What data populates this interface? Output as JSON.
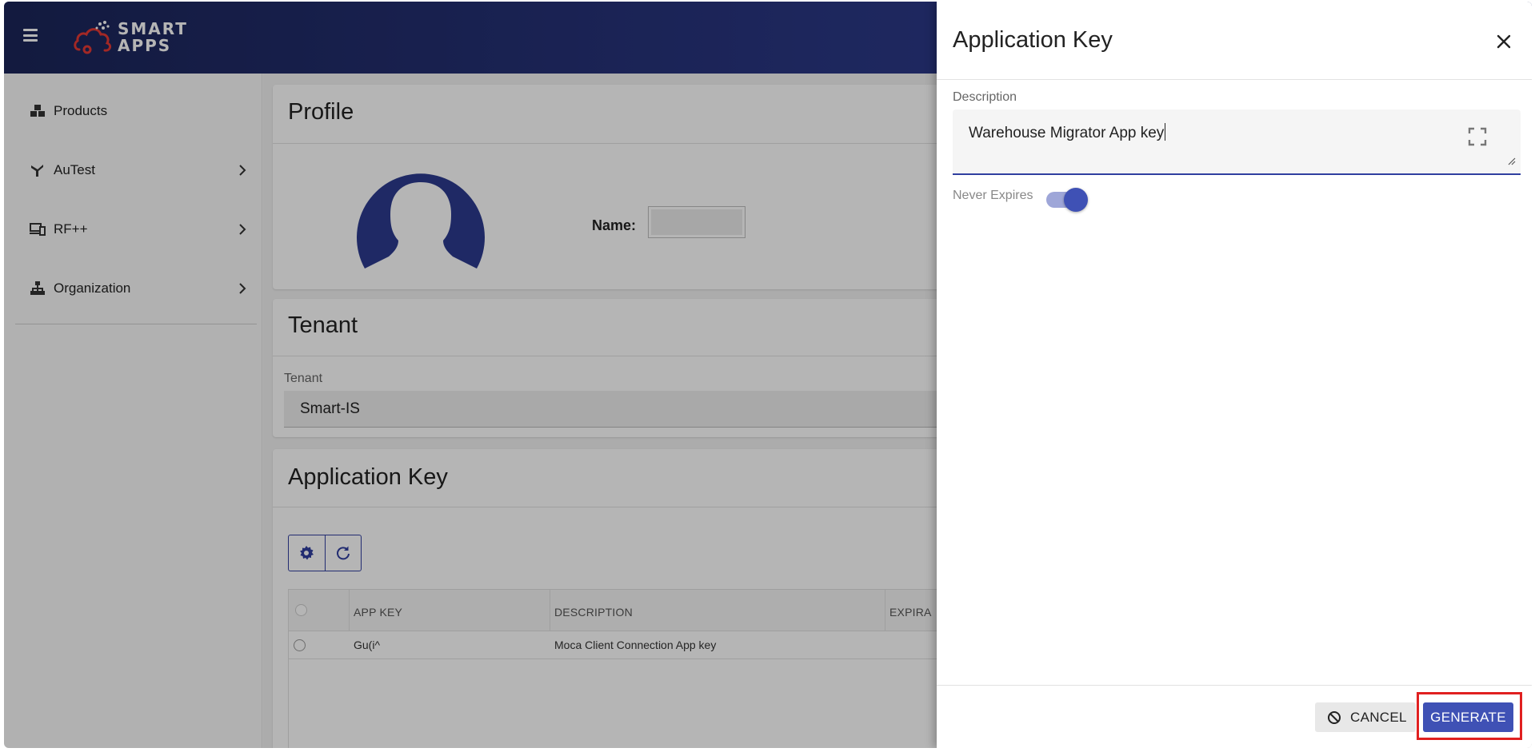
{
  "brand": {
    "logo_line1": "SMART",
    "logo_line2": "APPS"
  },
  "sidebar": {
    "items": [
      {
        "label": "Products",
        "icon": "boxes-icon"
      },
      {
        "label": "AuTest",
        "icon": "flask-icon"
      },
      {
        "label": "RF++",
        "icon": "devices-icon"
      },
      {
        "label": "Organization",
        "icon": "sitemap-icon"
      }
    ]
  },
  "profile": {
    "title": "Profile",
    "name_label": "Name:"
  },
  "tenant": {
    "title": "Tenant",
    "field_label": "Tenant",
    "value": "Smart-IS"
  },
  "app_keys": {
    "title": "Application Key",
    "columns": [
      "APP KEY",
      "DESCRIPTION",
      "EXPIRA"
    ],
    "rows": [
      {
        "app_key": "Gu(i^",
        "description": "Moca Client Connection App key"
      }
    ]
  },
  "dialog": {
    "title": "Application Key",
    "description_label": "Description",
    "description_value": "Warehouse Migrator App key",
    "never_expires_label": "Never Expires",
    "never_expires_on": true,
    "cancel_label": "CANCEL",
    "generate_label": "GENERATE"
  },
  "colors": {
    "primary": "#3f51b5",
    "topbar": "#2a3784",
    "highlight": "#e02020"
  }
}
